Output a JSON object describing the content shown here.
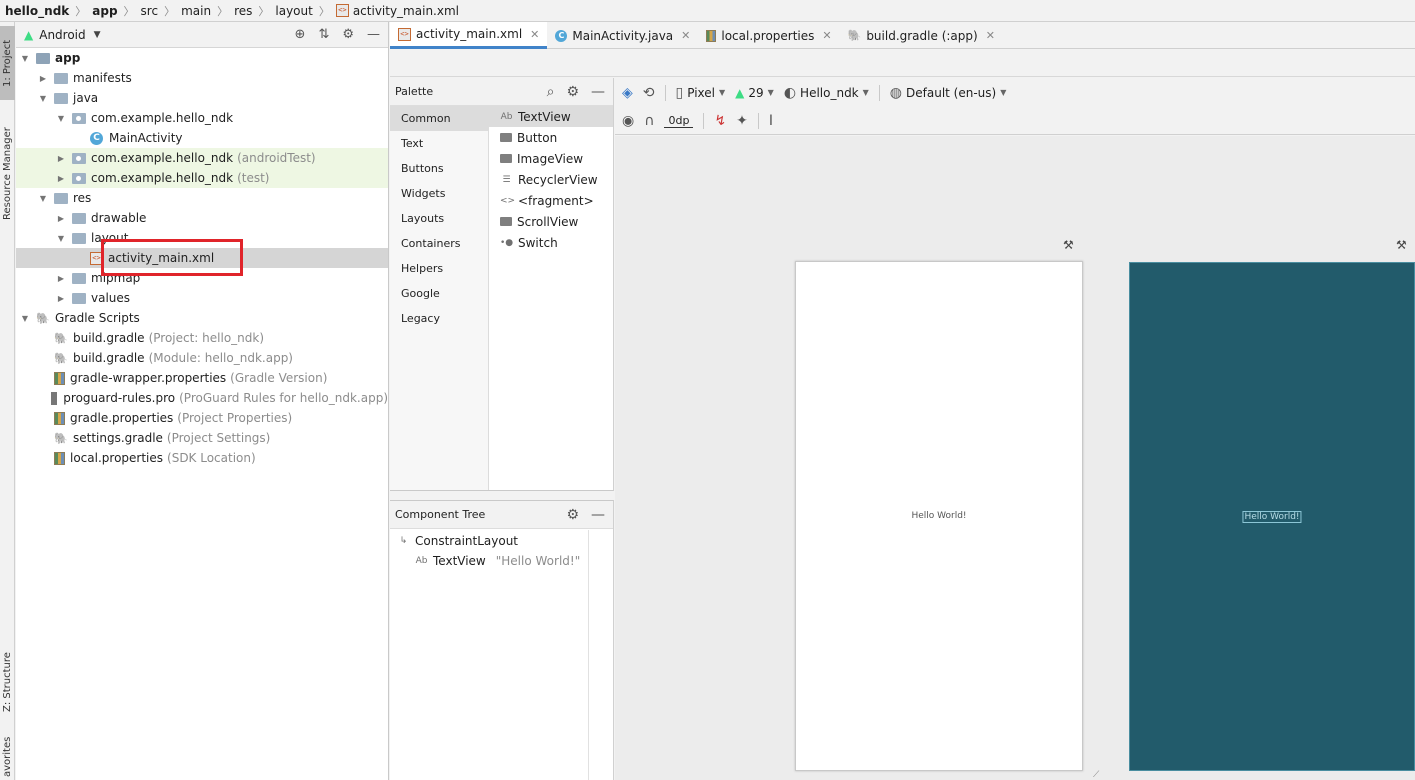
{
  "breadcrumb": [
    "hello_ndk",
    "app",
    "src",
    "main",
    "res",
    "layout",
    "activity_main.xml"
  ],
  "toolstrip": {
    "project": "1: Project",
    "resource_manager": "Resource Manager",
    "structure": "Z: Structure",
    "favorites": "avorites"
  },
  "project_panel": {
    "view_mode": "Android",
    "tree": [
      {
        "label": "app",
        "hint": "",
        "indent": 0,
        "expand": "open",
        "icon": "app-folder-icon",
        "bold": true
      },
      {
        "label": "manifests",
        "hint": "",
        "indent": 1,
        "expand": "closed",
        "icon": "folder-icon"
      },
      {
        "label": "java",
        "hint": "",
        "indent": 1,
        "expand": "open",
        "icon": "folder-icon"
      },
      {
        "label": "com.example.hello_ndk",
        "hint": "",
        "indent": 2,
        "expand": "open",
        "icon": "package-icon"
      },
      {
        "label": "MainActivity",
        "hint": "",
        "indent": 3,
        "expand": "none",
        "icon": "java-class-icon"
      },
      {
        "label": "com.example.hello_ndk",
        "hint": "(androidTest)",
        "indent": 2,
        "expand": "closed",
        "icon": "package-icon",
        "green": true
      },
      {
        "label": "com.example.hello_ndk",
        "hint": "(test)",
        "indent": 2,
        "expand": "closed",
        "icon": "package-icon",
        "green": true
      },
      {
        "label": "res",
        "hint": "",
        "indent": 1,
        "expand": "open",
        "icon": "res-folder-icon"
      },
      {
        "label": "drawable",
        "hint": "",
        "indent": 2,
        "expand": "closed",
        "icon": "folder-icon"
      },
      {
        "label": "layout",
        "hint": "",
        "indent": 2,
        "expand": "open",
        "icon": "folder-icon"
      },
      {
        "label": "activity_main.xml",
        "hint": "",
        "indent": 3,
        "expand": "none",
        "icon": "xml-file-icon",
        "selected": true
      },
      {
        "label": "mipmap",
        "hint": "",
        "indent": 2,
        "expand": "closed",
        "icon": "folder-icon"
      },
      {
        "label": "values",
        "hint": "",
        "indent": 2,
        "expand": "closed",
        "icon": "folder-icon"
      },
      {
        "label": "Gradle Scripts",
        "hint": "",
        "indent": 0,
        "expand": "open",
        "icon": "gradle-icon"
      },
      {
        "label": "build.gradle",
        "hint": "(Project: hello_ndk)",
        "indent": 1,
        "expand": "none",
        "icon": "gradle-icon"
      },
      {
        "label": "build.gradle",
        "hint": "(Module: hello_ndk.app)",
        "indent": 1,
        "expand": "none",
        "icon": "gradle-icon"
      },
      {
        "label": "gradle-wrapper.properties",
        "hint": "(Gradle Version)",
        "indent": 1,
        "expand": "none",
        "icon": "properties-icon"
      },
      {
        "label": "proguard-rules.pro",
        "hint": "(ProGuard Rules for hello_ndk.app)",
        "indent": 1,
        "expand": "none",
        "icon": "pro-file-icon"
      },
      {
        "label": "gradle.properties",
        "hint": "(Project Properties)",
        "indent": 1,
        "expand": "none",
        "icon": "properties-icon"
      },
      {
        "label": "settings.gradle",
        "hint": "(Project Settings)",
        "indent": 1,
        "expand": "none",
        "icon": "gradle-icon"
      },
      {
        "label": "local.properties",
        "hint": "(SDK Location)",
        "indent": 1,
        "expand": "none",
        "icon": "properties-icon"
      }
    ]
  },
  "tabs": [
    {
      "label": "activity_main.xml",
      "icon": "xml-file-icon",
      "active": true
    },
    {
      "label": "MainActivity.java",
      "icon": "java-class-icon",
      "active": false
    },
    {
      "label": "local.properties",
      "icon": "properties-icon",
      "active": false
    },
    {
      "label": "build.gradle (:app)",
      "icon": "gradle-icon",
      "active": false
    }
  ],
  "palette": {
    "title": "Palette",
    "categories": [
      "Common",
      "Text",
      "Buttons",
      "Widgets",
      "Layouts",
      "Containers",
      "Helpers",
      "Google",
      "Legacy"
    ],
    "selected_category": "Common",
    "items": [
      {
        "label": "TextView",
        "icon": "textview-icon",
        "glyph": "Ab"
      },
      {
        "label": "Button",
        "icon": "button-icon",
        "glyph": ""
      },
      {
        "label": "ImageView",
        "icon": "imageview-icon",
        "glyph": ""
      },
      {
        "label": "RecyclerView",
        "icon": "recyclerview-icon",
        "glyph": "☰"
      },
      {
        "label": "<fragment>",
        "icon": "fragment-icon",
        "glyph": "<>"
      },
      {
        "label": "ScrollView",
        "icon": "scrollview-icon",
        "glyph": ""
      },
      {
        "label": "Switch",
        "icon": "switch-icon",
        "glyph": "•●"
      }
    ]
  },
  "component_tree": {
    "title": "Component Tree",
    "root": "ConstraintLayout",
    "child_label": "TextView",
    "child_hint": "\"Hello World!\""
  },
  "design_toolbar": {
    "device": "Pixel",
    "api": "29",
    "theme": "Hello_ndk",
    "locale": "Default (en-us)",
    "margin": "0dp"
  },
  "canvas": {
    "design_text": "Hello World!",
    "blueprint_text": "Hello World!",
    "blueprint_color": "#225b6b"
  }
}
